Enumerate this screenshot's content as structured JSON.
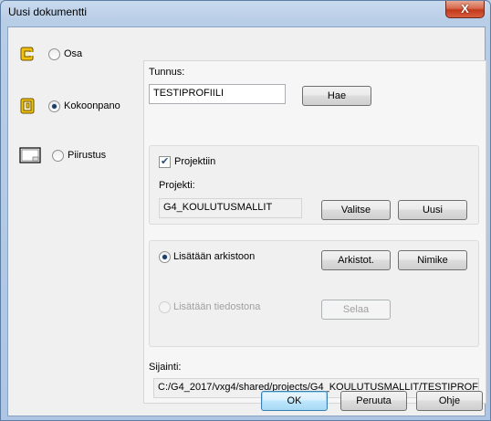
{
  "window": {
    "title": "Uusi dokumentti",
    "close_symbol": "X"
  },
  "types": [
    {
      "label": "Osa",
      "selected": false
    },
    {
      "label": "Kokoonpano",
      "selected": true
    },
    {
      "label": "Piirustus",
      "selected": false
    }
  ],
  "tunnus": {
    "label": "Tunnus:",
    "value": "TESTIPROFIILI",
    "button": "Hae"
  },
  "project": {
    "checkbox_label": "Projektiin",
    "checked": true,
    "project_label": "Projekti:",
    "project_value": "G4_KOULUTUSMALLIT",
    "select_button": "Valitse",
    "new_button": "Uusi"
  },
  "archive": {
    "option_archive": "Lisätään arkistoon",
    "archives_button": "Arkistot.",
    "title_button": "Nimike",
    "option_file": "Lisätään tiedostona",
    "browse_button": "Selaa"
  },
  "location": {
    "label": "Sijainti:",
    "value": "C:/G4_2017/vxg4/shared/projects/G4_KOULUTUSMALLIT/TESTIPROF"
  },
  "footer": {
    "ok": "OK",
    "cancel": "Peruuta",
    "help": "Ohje"
  }
}
